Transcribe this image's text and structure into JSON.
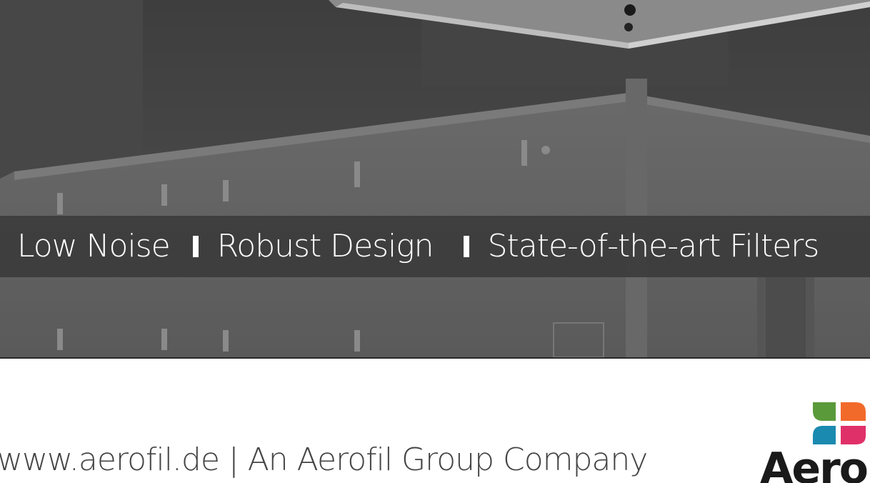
{
  "hero": {
    "tagline": {
      "item1": "Low Noise",
      "item2": "Robust Design",
      "item3": "State-of-the-art Filters"
    }
  },
  "footer": {
    "text": "www.aerofil.de  | An Aerofil Group Company",
    "logo_text": "Aero"
  },
  "colors": {
    "logo_green": "#5a9a3a",
    "logo_orange": "#f26a2a",
    "logo_blue": "#1a8ab0",
    "logo_pink": "#e0306a",
    "band": "#3c3c3c"
  }
}
